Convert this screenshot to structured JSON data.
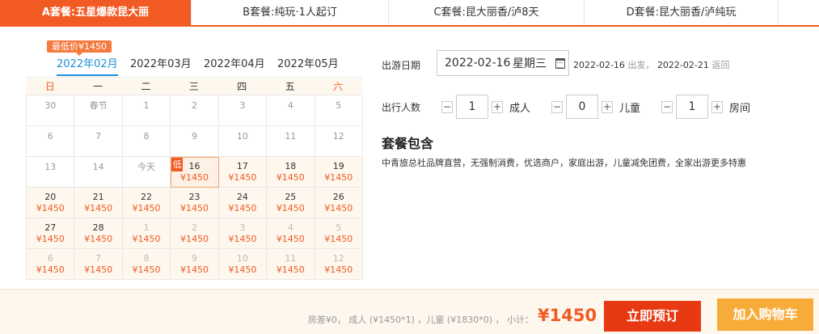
{
  "tabs": [
    {
      "label": "A套餐:五星爆款昆大丽"
    },
    {
      "label": "B套餐:纯玩·1人起订"
    },
    {
      "label": "C套餐:昆大丽香/泸8天"
    },
    {
      "label": "D套餐:昆大丽香/泸纯玩"
    }
  ],
  "calendar": {
    "lowest_badge": "最低价¥1450",
    "months": [
      "2022年02月",
      "2022年03月",
      "2022年04月",
      "2022年05月"
    ],
    "active_month": "2022年02月",
    "weekdays": [
      "日",
      "一",
      "二",
      "三",
      "四",
      "五",
      "六"
    ],
    "low_tag": "低",
    "cells": [
      {
        "day": "30",
        "price": "",
        "other": true
      },
      {
        "day": "春节",
        "price": "",
        "other": false
      },
      {
        "day": "1",
        "price": "",
        "other": false
      },
      {
        "day": "2",
        "price": "",
        "other": false
      },
      {
        "day": "3",
        "price": "",
        "other": false
      },
      {
        "day": "4",
        "price": "",
        "other": false
      },
      {
        "day": "5",
        "price": "",
        "other": false
      },
      {
        "day": "6",
        "price": "",
        "other": false
      },
      {
        "day": "7",
        "price": "",
        "other": false
      },
      {
        "day": "8",
        "price": "",
        "other": false
      },
      {
        "day": "9",
        "price": "",
        "other": false
      },
      {
        "day": "10",
        "price": "",
        "other": false
      },
      {
        "day": "11",
        "price": "",
        "other": false
      },
      {
        "day": "12",
        "price": "",
        "other": false
      },
      {
        "day": "13",
        "price": "",
        "other": false
      },
      {
        "day": "14",
        "price": "",
        "other": false
      },
      {
        "day": "今天",
        "price": "",
        "other": false
      },
      {
        "day": "16",
        "price": "¥1450",
        "other": false,
        "selected": true,
        "low": true
      },
      {
        "day": "17",
        "price": "¥1450",
        "other": false
      },
      {
        "day": "18",
        "price": "¥1450",
        "other": false
      },
      {
        "day": "19",
        "price": "¥1450",
        "other": false
      },
      {
        "day": "20",
        "price": "¥1450",
        "other": false
      },
      {
        "day": "21",
        "price": "¥1450",
        "other": false
      },
      {
        "day": "22",
        "price": "¥1450",
        "other": false
      },
      {
        "day": "23",
        "price": "¥1450",
        "other": false
      },
      {
        "day": "24",
        "price": "¥1450",
        "other": false
      },
      {
        "day": "25",
        "price": "¥1450",
        "other": false
      },
      {
        "day": "26",
        "price": "¥1450",
        "other": false
      },
      {
        "day": "27",
        "price": "¥1450",
        "other": false
      },
      {
        "day": "28",
        "price": "¥1450",
        "other": false
      },
      {
        "day": "1",
        "price": "¥1450",
        "other": true
      },
      {
        "day": "2",
        "price": "¥1450",
        "other": true
      },
      {
        "day": "3",
        "price": "¥1450",
        "other": true
      },
      {
        "day": "4",
        "price": "¥1450",
        "other": true
      },
      {
        "day": "5",
        "price": "¥1450",
        "other": true
      },
      {
        "day": "6",
        "price": "¥1450",
        "other": true
      },
      {
        "day": "7",
        "price": "¥1450",
        "other": true
      },
      {
        "day": "8",
        "price": "¥1450",
        "other": true
      },
      {
        "day": "9",
        "price": "¥1450",
        "other": true
      },
      {
        "day": "10",
        "price": "¥1450",
        "other": true
      },
      {
        "day": "11",
        "price": "¥1450",
        "other": true
      },
      {
        "day": "12",
        "price": "¥1450",
        "other": true
      }
    ]
  },
  "departure": {
    "label": "出游日期",
    "date": "2022-02-16",
    "weekday": "星期三",
    "start": "2022-02-16",
    "start_suffix": "出发，",
    "end": "2022-02-21",
    "end_suffix": "返回"
  },
  "travelers": {
    "label": "出行人数",
    "minus": "−",
    "plus": "+",
    "items": [
      {
        "name": "成人",
        "value": "1"
      },
      {
        "name": "儿童",
        "value": "0"
      },
      {
        "name": "房间",
        "value": "1"
      }
    ]
  },
  "package": {
    "title": "套餐包含",
    "description": "中青旅总社品牌直营，无强制消费，优选商户，家庭出游，儿童减免团费，全家出游更多特惠"
  },
  "footer": {
    "summary": "房差¥0，  成人 (¥1450*1) ，儿童 (¥1830*0) ，  小计：",
    "total": "¥1450",
    "book_label": "立即预订",
    "cart_label": "加入购物车"
  },
  "colors": {
    "accent": "#f25a23",
    "link": "#1e8fd5",
    "cart": "#f7ac3a"
  }
}
